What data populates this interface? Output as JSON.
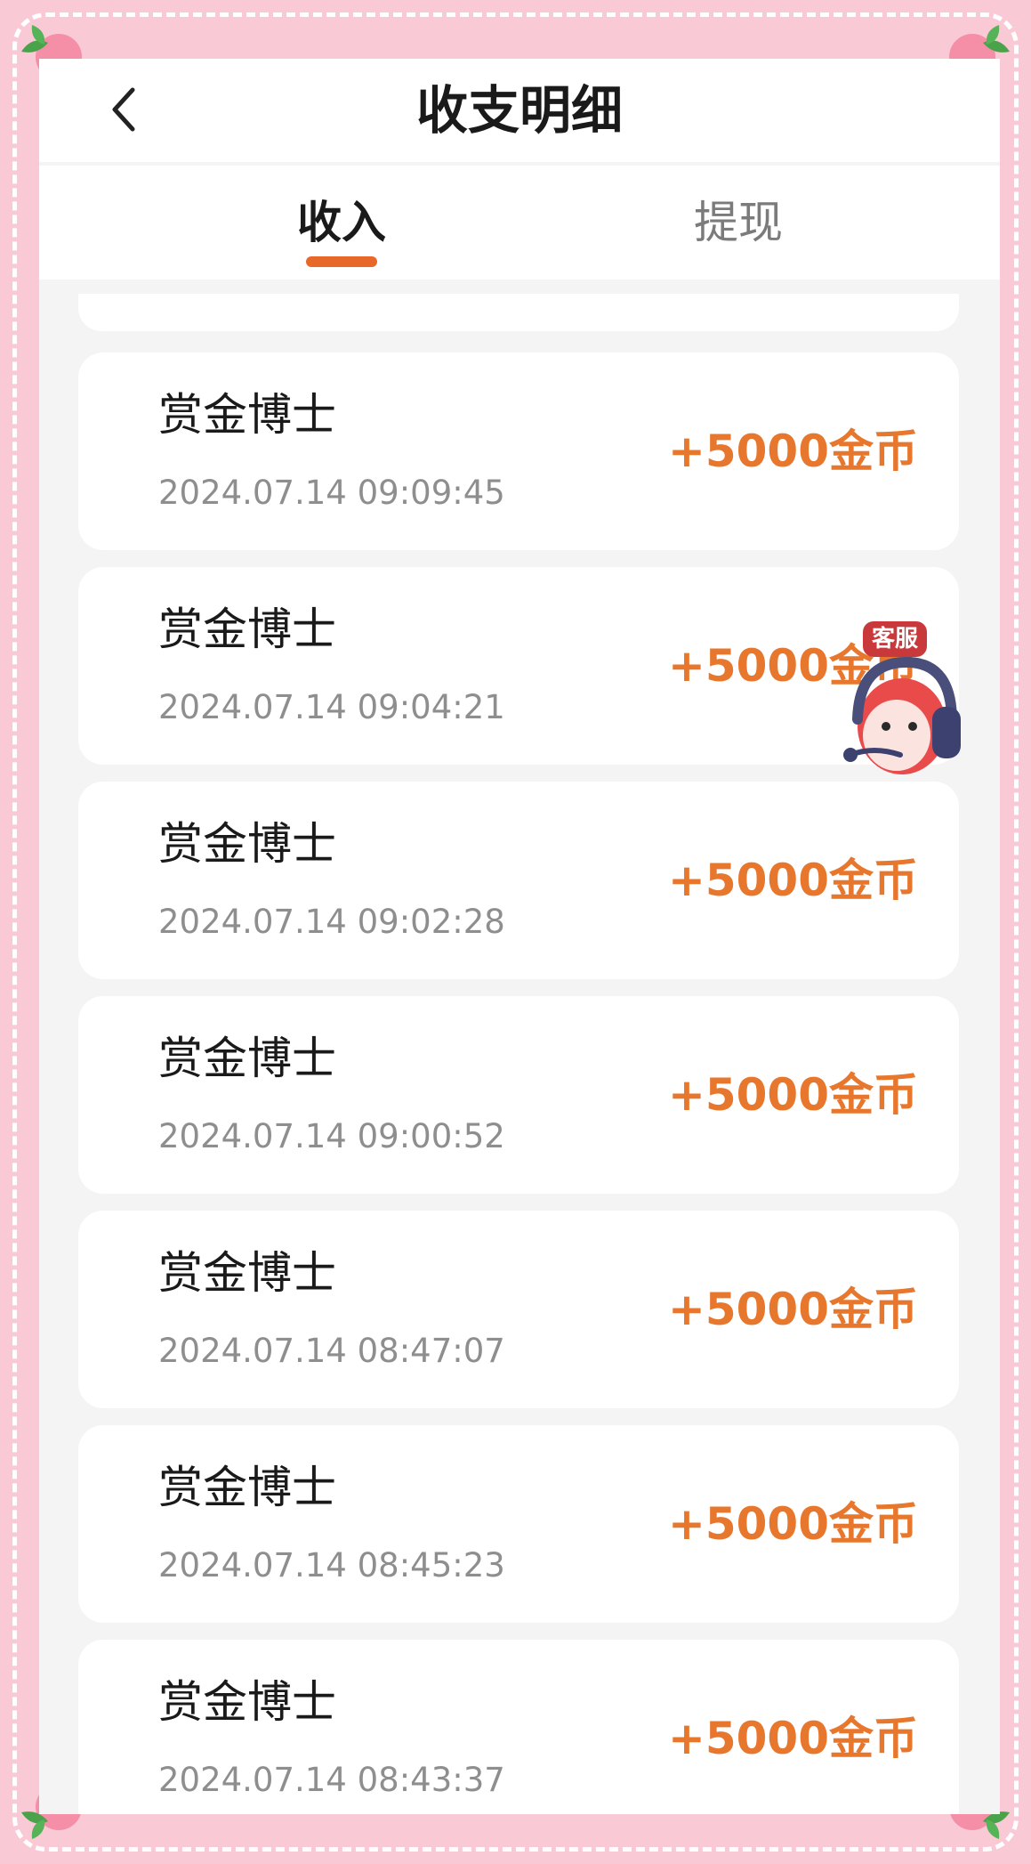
{
  "header": {
    "title": "收支明细",
    "back_icon": "chevron-left-icon"
  },
  "tabs": [
    {
      "label": "收入",
      "active": true
    },
    {
      "label": "提现",
      "active": false
    }
  ],
  "records": [
    {
      "title": "赏金博士",
      "time": "2024.07.14 09:09:45",
      "amount": "+5000金币"
    },
    {
      "title": "赏金博士",
      "time": "2024.07.14 09:04:21",
      "amount": "+5000金币"
    },
    {
      "title": "赏金博士",
      "time": "2024.07.14 09:02:28",
      "amount": "+5000金币"
    },
    {
      "title": "赏金博士",
      "time": "2024.07.14 09:00:52",
      "amount": "+5000金币"
    },
    {
      "title": "赏金博士",
      "time": "2024.07.14 08:47:07",
      "amount": "+5000金币"
    },
    {
      "title": "赏金博士",
      "time": "2024.07.14 08:45:23",
      "amount": "+5000金币"
    },
    {
      "title": "赏金博士",
      "time": "2024.07.14 08:43:37",
      "amount": "+5000金币"
    }
  ],
  "customer_service": {
    "label": "客服",
    "icon": "headset-mascot-icon"
  },
  "colors": {
    "accent": "#e8682a",
    "amount": "#e8772e",
    "frame_background": "#f9c9d6"
  }
}
